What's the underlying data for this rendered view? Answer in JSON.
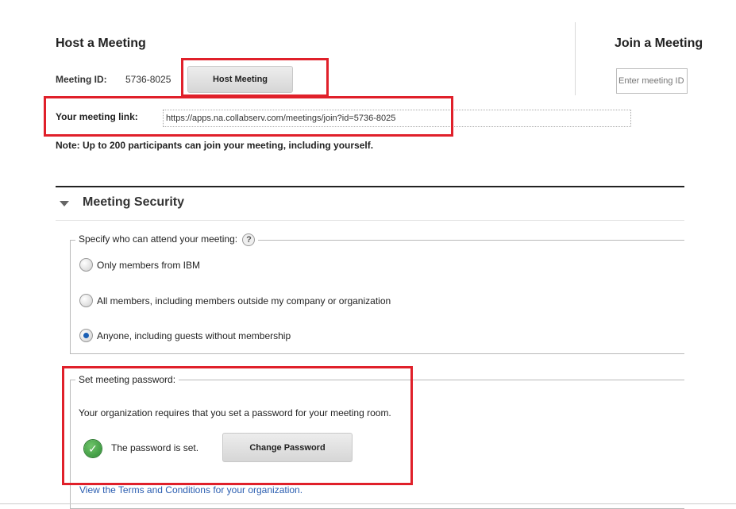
{
  "host": {
    "title": "Host a Meeting",
    "meeting_id_label": "Meeting ID:",
    "meeting_id_value": "5736-8025",
    "host_button_label": "Host Meeting",
    "link_label": "Your meeting link:",
    "link_value": "https://apps.na.collabserv.com/meetings/join?id=5736-8025",
    "note": "Note: Up to 200 participants can join your meeting, including yourself."
  },
  "join": {
    "title": "Join a Meeting",
    "input_placeholder": "Enter meeting ID"
  },
  "security": {
    "section_title": "Meeting Security",
    "attend_legend": "Specify who can attend your meeting:",
    "help_icon": "?",
    "options": [
      {
        "label": "Only members from IBM",
        "checked": false
      },
      {
        "label": "All members, including members outside my company or organization",
        "checked": false
      },
      {
        "label": "Anyone, including guests without membership",
        "checked": true
      }
    ],
    "password_legend": "Set meeting password:",
    "password_requirement": "Your organization requires that you set a password for your meeting room.",
    "password_status": "The password is set.",
    "change_password_label": "Change Password",
    "terms_link": "View the Terms and Conditions for your organization."
  },
  "colors": {
    "highlight": "#e0202a",
    "link": "#2a5db0",
    "check_green": "#2e8b34",
    "radio_selected": "#1a5fb4"
  }
}
